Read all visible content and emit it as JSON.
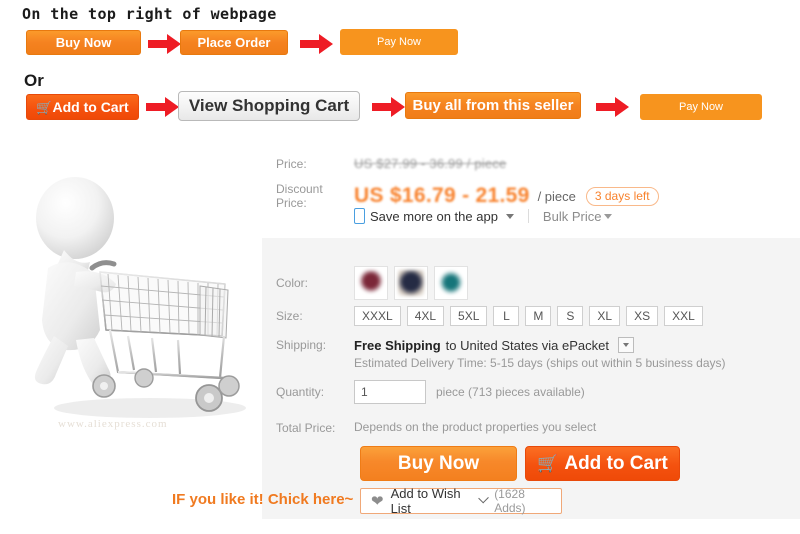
{
  "instructions": {
    "heading_top": "On the top right of webpage",
    "or_label": "Or",
    "flow_top": [
      {
        "label": "Buy Now",
        "style": "orange"
      },
      {
        "label": "Place Order",
        "style": "orange"
      },
      {
        "label": "Pay Now",
        "style": "orange-flat"
      }
    ],
    "flow_bottom": [
      {
        "label": "Add to Cart",
        "style": "red",
        "icon": "cart-icon"
      },
      {
        "label": "View Shopping Cart",
        "style": "grey"
      },
      {
        "label": "Buy all from this seller",
        "style": "orange"
      },
      {
        "label": "Pay Now",
        "style": "orange-flat"
      }
    ],
    "arrow_icon": "right-arrow-icon",
    "arrow_color": "#ee1c25"
  },
  "product_image": {
    "alt": "3d-figure-pushing-shopping-cart",
    "watermark": "www.aliexpress.com"
  },
  "price": {
    "label": "Price:",
    "original": "US $27.99 - 36.99 / piece",
    "discount_label": "Discount Price:",
    "discount": "US $16.79 - 21.59",
    "unit": "/ piece",
    "badge": "3 days left",
    "app_save": "Save more on the app",
    "bulk_price": "Bulk Price",
    "accent_color": "#f8832f"
  },
  "options": {
    "color_label": "Color:",
    "colors": [
      {
        "name": "maroon",
        "hex": "#7b2738"
      },
      {
        "name": "navy",
        "hex": "#252b44"
      },
      {
        "name": "teal",
        "hex": "#16757a"
      }
    ],
    "size_label": "Size:",
    "sizes": [
      "XXXL",
      "4XL",
      "5XL",
      "L",
      "M",
      "S",
      "XL",
      "XS",
      "XXL"
    ]
  },
  "shipping": {
    "label": "Shipping:",
    "free_text": "Free Shipping",
    "to_text": "to United States via ePacket",
    "estimate": "Estimated Delivery Time: 5-15 days (ships out within 5 business days)"
  },
  "quantity": {
    "label": "Quantity:",
    "value": "1",
    "note": "piece (713 pieces available)"
  },
  "total": {
    "label": "Total Price:",
    "note": "Depends on the product properties you select"
  },
  "actions": {
    "buy_now": "Buy Now",
    "add_to_cart": "Add to Cart",
    "cart_icon": "shopping-cart-icon"
  },
  "wishlist": {
    "hint": "IF you like it! Chick here~",
    "label": "Add to Wish List",
    "count": "(1628 Adds)",
    "heart_icon": "heart-icon"
  }
}
